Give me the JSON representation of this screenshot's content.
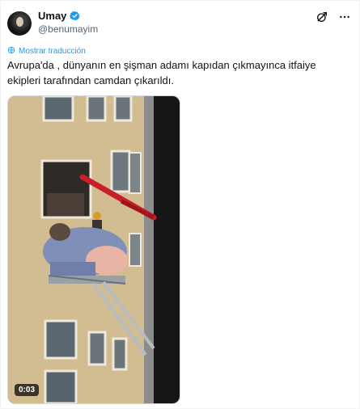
{
  "user": {
    "display_name": "Umay",
    "handle": "@benumayim"
  },
  "actions": {
    "grok_icon": "grok-icon",
    "more_icon": "more-icon"
  },
  "translate": {
    "label": "Mostrar traducción"
  },
  "tweet": {
    "text": "Avrupa'da , dünyanın en şişman adamı kapıdan çıkmayınca itfaiye ekipleri tarafından camdan çıkarıldı."
  },
  "video": {
    "duration": "0:03"
  },
  "colors": {
    "accent": "#1d9bf0",
    "text": "#0f1419",
    "secondary": "#536471"
  }
}
